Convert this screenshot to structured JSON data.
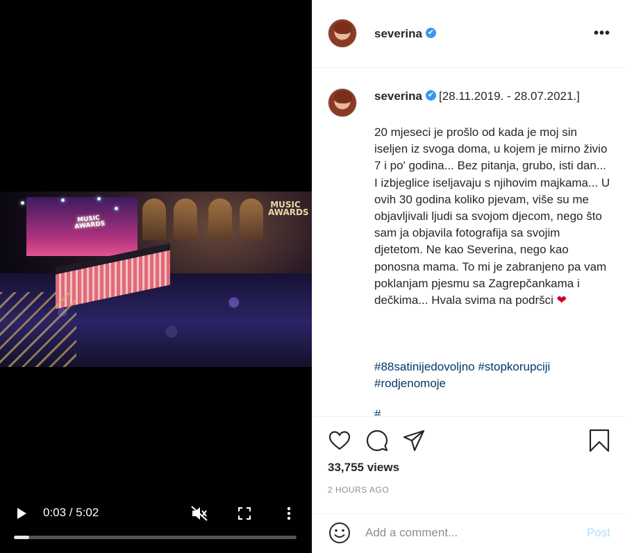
{
  "video": {
    "time_display": "0:03 / 5:02",
    "progress": 0.01,
    "stage_logo_text": "MUSIC AWARDS",
    "hall_logo_text": "MUSIC AWARDS",
    "icons": {
      "play": "play-icon",
      "mute": "mute-icon",
      "fullscreen": "fullscreen-icon",
      "more": "kebab-icon"
    }
  },
  "header": {
    "username": "severina",
    "verified_glyph": "✔",
    "more_label": "•••"
  },
  "caption": {
    "username": "severina",
    "date_range": "[28.11.2019. - 28.07.2021.]",
    "body": "20 mjeseci je prošlo od kada je moj sin iseljen iz svoga doma, u kojem je mirno živio 7 i po' godina... Bez pitanja, grubo, isti dan... I izbjeglice iseljavaju s njihovim majkama... U ovih 30 godina koliko pjevam, više su me objavljivali ljudi sa svojom djecom, nego što sam ja objavila fotografija sa svojim djetetom. Ne kao Severina, nego kao ponosna mama. To mi je zabranjeno pa vam poklanjam pjesmu sa Zagrepčankama i dečkima... Hvala svima na podršci",
    "heart": "❤",
    "hashtags": [
      "#88satinijedovoljno",
      "#stopkorupciji",
      "#rodjenomoje"
    ],
    "faded_text": "#..."
  },
  "actions": {
    "views": "33,755 views",
    "time_ago": "2 HOURS AGO"
  },
  "comment": {
    "placeholder": "Add a comment...",
    "post_label": "Post"
  },
  "colors": {
    "link": "#00376b",
    "verified": "#3897f0",
    "post_disabled": "#b2dffc",
    "muted": "#8e8e8e"
  }
}
